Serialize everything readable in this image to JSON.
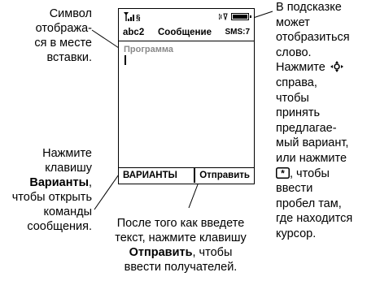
{
  "callouts": {
    "top_left": [
      "Символ",
      "отобража-",
      "ся в месте",
      "вставки."
    ],
    "bottom_left": {
      "line1": "Нажмите",
      "line2": "клавишу",
      "bold": "Варианты",
      "line3_suffix": ",",
      "line4": "чтобы открыть",
      "line5": "команды",
      "line6": "сообщения."
    },
    "bottom_center": {
      "line1": "После того как введете",
      "line2": "текст, нажмите клавишу",
      "bold": "Отправить",
      "line3_suffix": ", чтобы",
      "line4": "ввести получателей."
    },
    "right": {
      "l1": "В подсказке",
      "l2": "может",
      "l3": "отобразиться",
      "l4": "слово.",
      "l5": "Нажмите",
      "l6": "справа,",
      "l7": "чтобы",
      "l8": "принять",
      "l9": "предлагае-",
      "l10": "мый вариант,",
      "l11": "или нажмите",
      "l12": ", чтобы",
      "l13": "ввести",
      "l14": "пробел там,",
      "l15": "где находится",
      "l16": "курсор."
    }
  },
  "screen": {
    "mode": "abc2",
    "title": "Сообщение",
    "sms": "SMS:7",
    "entry_text": "Программа",
    "left_softkey": "ВАРИАНТЫ",
    "right_softkey": "Отправить"
  },
  "icons": [
    "signal-icon",
    "message-icon",
    "ring-icon",
    "battery-icon",
    "nav-key-icon",
    "star-key-icon"
  ]
}
